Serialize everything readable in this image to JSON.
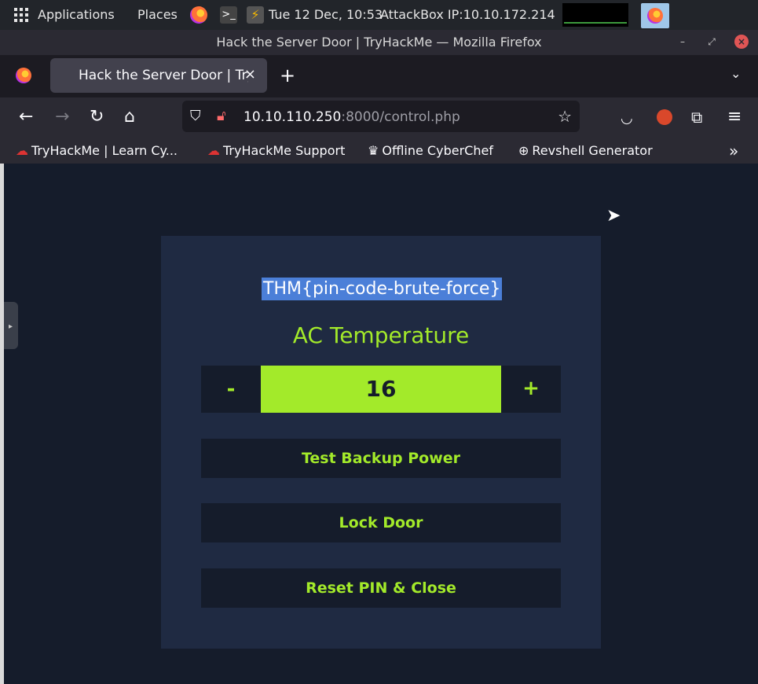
{
  "desktop_panel": {
    "applications": "Applications",
    "places": "Places",
    "clock": "Tue 12 Dec, 10:53",
    "attackbox_ip": "AttackBox IP:10.10.172.214"
  },
  "window": {
    "title": "Hack the Server Door | TryHackMe — Mozilla Firefox"
  },
  "tabs": [
    {
      "label": "Hack the Server Door | TryHackMe"
    }
  ],
  "address_bar": {
    "host": "10.10.110.250",
    "rest": ":8000/control.php"
  },
  "bookmarks": [
    {
      "label": "TryHackMe | Learn Cy..."
    },
    {
      "label": "TryHackMe Support"
    },
    {
      "label": "Offline CyberChef"
    },
    {
      "label": "Revshell Generator"
    }
  ],
  "page": {
    "flag": "THM{pin-code-brute-force}",
    "ac_title": "AC Temperature",
    "decrement": "-",
    "temperature": "16",
    "increment": "+",
    "buttons": {
      "backup_power": "Test Backup Power",
      "lock_door": "Lock Door",
      "reset_pin": "Reset PIN & Close"
    }
  },
  "colors": {
    "accent_green": "#a3ea2a",
    "card_bg": "#1f2a42",
    "page_bg": "#151c2b",
    "selection": "#4b7fd8"
  }
}
